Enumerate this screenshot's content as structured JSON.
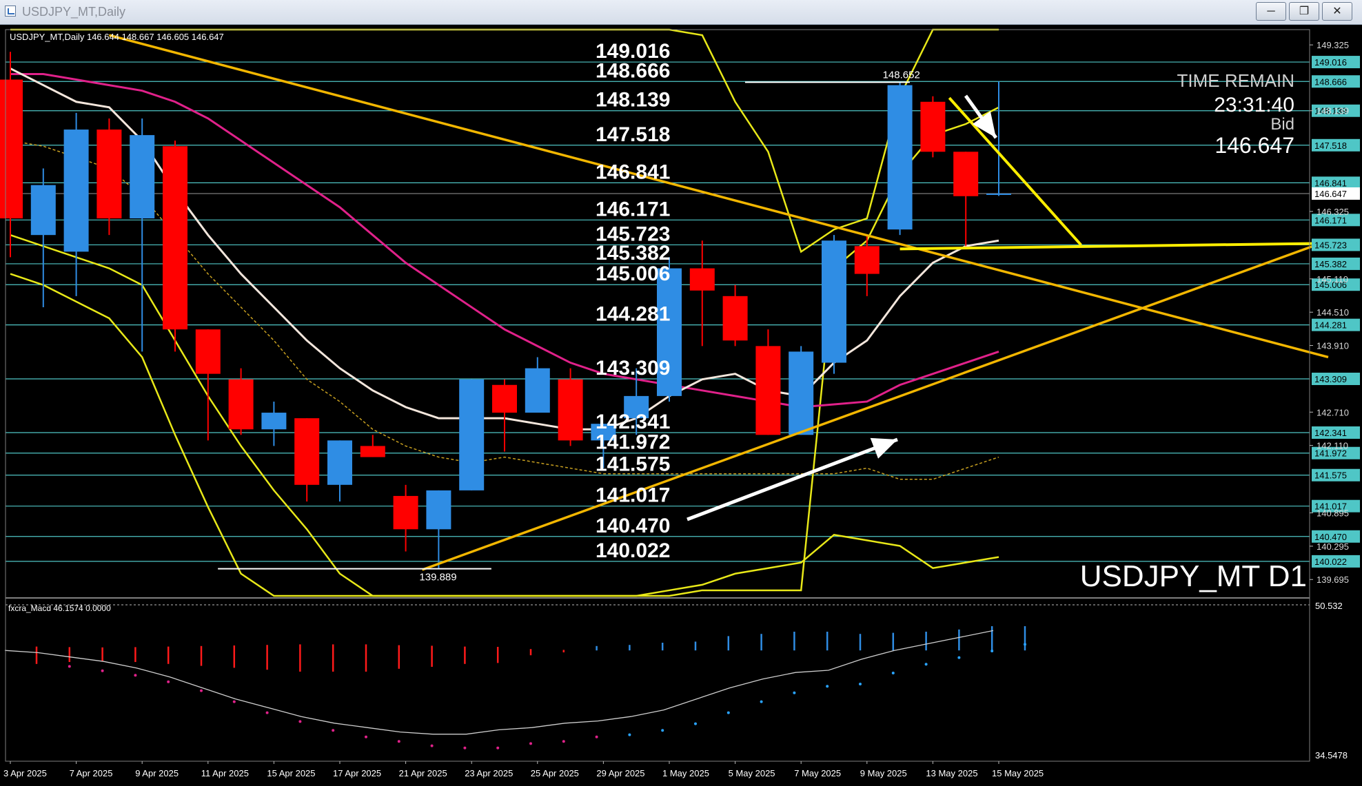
{
  "window": {
    "title": "USDJPY_MT,Daily",
    "minimize_icon": "minimize-icon",
    "maximize_icon": "restore-icon",
    "close_icon": "close-icon"
  },
  "chart_data": {
    "type": "candlestick",
    "symbol": "USDJPY_MT",
    "header": "USDJPY_MT,Daily  146.644 148.667 146.605 146.647",
    "watermark": "USDJPY_MT D1",
    "time_remain_label": "TIME REMAIN",
    "time_remain": "23:31:40",
    "bid_label": "Bid",
    "bid": "146.647",
    "current_price": 146.647,
    "ylim": [
      139.4,
      149.6
    ],
    "right_axis_ticks": [
      "149.325",
      "148.139",
      "146.325",
      "145.110",
      "144.510",
      "143.910",
      "142.710",
      "142.110",
      "140.895",
      "140.295",
      "139.695"
    ],
    "levels": [
      149.016,
      148.666,
      148.139,
      147.518,
      146.841,
      146.171,
      145.723,
      145.382,
      145.006,
      144.281,
      143.309,
      142.341,
      141.972,
      141.575,
      141.017,
      140.47,
      140.022
    ],
    "level_labels": [
      "149.016",
      "148.666",
      "148.139",
      "147.518",
      "146.841",
      "146.171",
      "145.723",
      "145.382",
      "145.006",
      "144.281",
      "143.309",
      "142.341",
      "141.972",
      "141.575",
      "141.017",
      "140.470",
      "140.022"
    ],
    "high_marker": {
      "label": "148.652",
      "value": 148.652
    },
    "low_marker": {
      "label": "139.889",
      "value": 139.889
    },
    "x_labels": [
      "3 Apr 2025",
      "7 Apr 2025",
      "9 Apr 2025",
      "11 Apr 2025",
      "15 Apr 2025",
      "17 Apr 2025",
      "21 Apr 2025",
      "23 Apr 2025",
      "25 Apr 2025",
      "29 Apr 2025",
      "1 May 2025",
      "5 May 2025",
      "7 May 2025",
      "9 May 2025",
      "13 May 2025",
      "15 May 2025"
    ],
    "candles": [
      {
        "o": 148.7,
        "h": 149.2,
        "l": 145.5,
        "c": 146.2
      },
      {
        "o": 145.9,
        "h": 147.1,
        "l": 144.6,
        "c": 146.8
      },
      {
        "o": 145.6,
        "h": 148.1,
        "l": 144.8,
        "c": 147.8
      },
      {
        "o": 147.8,
        "h": 148.0,
        "l": 145.9,
        "c": 146.2
      },
      {
        "o": 146.2,
        "h": 148.0,
        "l": 143.8,
        "c": 147.7
      },
      {
        "o": 147.5,
        "h": 147.6,
        "l": 143.8,
        "c": 144.2
      },
      {
        "o": 144.2,
        "h": 144.2,
        "l": 142.2,
        "c": 143.4
      },
      {
        "o": 143.3,
        "h": 143.5,
        "l": 142.3,
        "c": 142.4
      },
      {
        "o": 142.4,
        "h": 142.9,
        "l": 142.1,
        "c": 142.7
      },
      {
        "o": 142.6,
        "h": 142.6,
        "l": 141.1,
        "c": 141.4
      },
      {
        "o": 141.4,
        "h": 142.2,
        "l": 141.1,
        "c": 142.2
      },
      {
        "o": 142.1,
        "h": 142.3,
        "l": 141.9,
        "c": 141.9
      },
      {
        "o": 141.2,
        "h": 141.4,
        "l": 140.2,
        "c": 140.6
      },
      {
        "o": 140.6,
        "h": 141.3,
        "l": 139.889,
        "c": 141.3
      },
      {
        "o": 141.3,
        "h": 143.3,
        "l": 141.3,
        "c": 143.3
      },
      {
        "o": 143.2,
        "h": 143.3,
        "l": 142.0,
        "c": 142.7
      },
      {
        "o": 142.7,
        "h": 143.7,
        "l": 142.7,
        "c": 143.5
      },
      {
        "o": 143.3,
        "h": 143.5,
        "l": 142.1,
        "c": 142.2
      },
      {
        "o": 142.2,
        "h": 142.5,
        "l": 141.7,
        "c": 142.5
      },
      {
        "o": 142.6,
        "h": 143.5,
        "l": 142.3,
        "c": 143.0
      },
      {
        "o": 143.0,
        "h": 145.5,
        "l": 142.9,
        "c": 145.3
      },
      {
        "o": 145.3,
        "h": 145.8,
        "l": 143.9,
        "c": 144.9
      },
      {
        "o": 144.8,
        "h": 145.0,
        "l": 143.9,
        "c": 144.0
      },
      {
        "o": 143.9,
        "h": 144.2,
        "l": 142.3,
        "c": 142.3
      },
      {
        "o": 142.3,
        "h": 143.9,
        "l": 142.3,
        "c": 143.8
      },
      {
        "o": 143.6,
        "h": 145.9,
        "l": 143.4,
        "c": 145.8
      },
      {
        "o": 145.7,
        "h": 145.9,
        "l": 144.8,
        "c": 145.2
      },
      {
        "o": 146.0,
        "h": 148.652,
        "l": 145.9,
        "c": 148.6
      },
      {
        "o": 148.3,
        "h": 148.4,
        "l": 147.3,
        "c": 147.4
      },
      {
        "o": 147.4,
        "h": 147.4,
        "l": 145.7,
        "c": 146.6
      },
      {
        "o": 146.644,
        "h": 148.667,
        "l": 146.605,
        "c": 146.647
      }
    ],
    "ma_white": [
      148.9,
      148.6,
      148.3,
      148.2,
      147.6,
      146.7,
      145.9,
      145.2,
      144.6,
      144.0,
      143.5,
      143.1,
      142.8,
      142.6,
      142.6,
      142.6,
      142.5,
      142.4,
      142.4,
      142.6,
      143.0,
      143.3,
      143.4,
      143.1,
      143.0,
      143.6,
      144.0,
      144.8,
      145.4,
      145.7,
      145.8
    ],
    "ma_magenta": [
      148.8,
      148.8,
      148.7,
      148.6,
      148.5,
      148.3,
      148.0,
      147.6,
      147.2,
      146.8,
      146.4,
      145.9,
      145.4,
      145.0,
      144.6,
      144.2,
      143.9,
      143.6,
      143.4,
      143.3,
      143.2,
      143.1,
      143.0,
      142.9,
      142.8,
      142.85,
      142.9,
      143.2,
      143.4,
      143.6,
      143.8
    ],
    "ma_dashed": [
      147.6,
      147.5,
      147.3,
      147.1,
      146.6,
      145.9,
      145.2,
      144.6,
      144.0,
      143.3,
      142.9,
      142.4,
      142.1,
      141.9,
      141.8,
      141.9,
      141.8,
      141.7,
      141.6,
      141.6,
      141.6,
      141.6,
      141.6,
      141.6,
      141.6,
      141.6,
      141.7,
      141.5,
      141.5,
      141.7,
      141.9
    ],
    "bb_upper": [
      149.6,
      149.6,
      149.6,
      149.6,
      149.6,
      149.6,
      149.6,
      149.6,
      149.6,
      149.6,
      149.6,
      149.6,
      149.6,
      149.6,
      149.6,
      149.6,
      149.6,
      149.6,
      149.6,
      149.6,
      149.6,
      149.5,
      148.3,
      147.4,
      145.6,
      146.0,
      146.2,
      148.4,
      149.6,
      149.6,
      149.6
    ],
    "bb_mid": [
      145.9,
      145.7,
      145.5,
      145.3,
      145.0,
      144.0,
      143.0,
      142.1,
      141.3,
      140.6,
      139.8,
      139.4,
      139.4,
      139.4,
      139.4,
      139.4,
      139.4,
      139.4,
      139.4,
      139.4,
      139.4,
      139.5,
      139.5,
      139.5,
      139.5,
      145.3,
      145.8,
      147.0,
      147.7,
      147.9,
      148.2
    ],
    "bb_lower": [
      145.2,
      145.0,
      144.7,
      144.4,
      143.7,
      142.3,
      141.0,
      139.8,
      139.4,
      139.4,
      139.4,
      139.4,
      139.4,
      139.4,
      139.4,
      139.4,
      139.4,
      139.4,
      139.4,
      139.4,
      139.5,
      139.6,
      139.8,
      139.9,
      140.0,
      140.5,
      140.4,
      140.3,
      139.9,
      140.0,
      140.1
    ],
    "trendlines": [
      {
        "name": "down-trendline",
        "from": {
          "i": 3,
          "v": 149.5
        },
        "to": {
          "i": 40,
          "v": 143.7
        }
      },
      {
        "name": "up-trendline",
        "from": {
          "i": 12.5,
          "v": 139.87
        },
        "to": {
          "i": 40,
          "v": 145.8
        }
      },
      {
        "name": "channel-line",
        "from": {
          "i": 28.5,
          "v": 148.37
        },
        "to": {
          "i": 32.5,
          "v": 145.72
        }
      },
      {
        "name": "horizontal-support",
        "from": {
          "i": 27,
          "v": 145.65
        },
        "to": {
          "i": 40,
          "v": 145.75
        }
      }
    ],
    "macd": {
      "label": "fxcra_Macd 46.1574  0.0000",
      "top_value": "50.532",
      "bottom_value": "34.5478",
      "histogram": [
        1.4,
        1.2,
        1.1,
        1.2,
        1.4,
        1.6,
        1.8,
        2.0,
        2.2,
        2.2,
        2.2,
        1.9,
        1.7,
        1.4,
        1.3,
        0.5,
        0.2,
        -0.4,
        -0.5,
        -0.7,
        -0.8,
        -1.3,
        -1.5,
        -1.7,
        -1.7,
        -1.5,
        -1.6,
        -1.7,
        -1.9,
        -2.2,
        -2.2,
        -2.1,
        -2.0
      ],
      "signal_line": [
        0.9,
        0.8,
        0.6,
        0.4,
        0.1,
        -0.3,
        -0.8,
        -1.3,
        -1.7,
        -2.1,
        -2.4,
        -2.6,
        -2.8,
        -2.9,
        -2.9,
        -2.7,
        -2.6,
        -2.4,
        -2.3,
        -2.1,
        -1.8,
        -1.3,
        -0.8,
        -0.4,
        -0.1,
        0.0,
        0.5,
        0.9,
        1.2,
        1.5,
        1.8,
        2.1,
        2.3
      ],
      "ylim": [
        -3.5,
        2.5
      ]
    }
  }
}
